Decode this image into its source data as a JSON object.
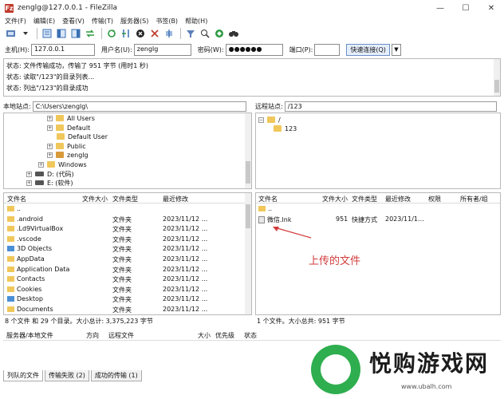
{
  "window": {
    "title": "zenglg@127.0.0.1 - FileZilla",
    "app_icon": "Fz",
    "minimize": "—",
    "maximize": "☐",
    "close": "✕"
  },
  "menu": [
    "文件(F)",
    "编辑(E)",
    "查看(V)",
    "传输(T)",
    "服务器(S)",
    "书签(B)",
    "帮助(H)"
  ],
  "quickconnect": {
    "host_label": "主机(H):",
    "host_value": "127.0.0.1",
    "user_label": "用户名(U):",
    "user_value": "zenglg",
    "pass_label": "密码(W):",
    "pass_value": "●●●●●●",
    "port_label": "端口(P):",
    "port_value": "",
    "connect_label": "快速连接(Q)",
    "dropdown_icon": "▼"
  },
  "log": [
    "状态: 文件传输成功，传输了 951 字节 (用时1 秒)",
    "状态: 读取\"/123\"的目录列表...",
    "状态: 列出\"/123\"的目录成功"
  ],
  "local": {
    "site_label": "本地站点:",
    "site_path": "C:\\Users\\zenglg\\",
    "tree": [
      {
        "label": "All Users",
        "kind": "folder"
      },
      {
        "label": "Default",
        "kind": "folder"
      },
      {
        "label": "Default User",
        "kind": "folder"
      },
      {
        "label": "Public",
        "kind": "folder"
      },
      {
        "label": "zenglg",
        "kind": "user"
      },
      {
        "label": "Windows",
        "kind": "folder"
      },
      {
        "label": "D: (代码)",
        "kind": "drive"
      },
      {
        "label": "E: (软件)",
        "kind": "drive"
      }
    ],
    "columns": [
      "文件名",
      "文件大小",
      "文件类型",
      "最近修改"
    ],
    "rows": [
      {
        "name": "..",
        "size": "",
        "type": "",
        "modified": "",
        "icon": "folder"
      },
      {
        "name": ".android",
        "size": "",
        "type": "文件夹",
        "modified": "2023/11/12 ...",
        "icon": "folder"
      },
      {
        "name": ".Ld9VirtualBox",
        "size": "",
        "type": "文件夹",
        "modified": "2023/11/12 ...",
        "icon": "folder"
      },
      {
        "name": ".vscode",
        "size": "",
        "type": "文件夹",
        "modified": "2023/11/12 ...",
        "icon": "folder"
      },
      {
        "name": "3D Objects",
        "size": "",
        "type": "文件夹",
        "modified": "2023/11/12 ...",
        "icon": "blue"
      },
      {
        "name": "AppData",
        "size": "",
        "type": "文件夹",
        "modified": "2023/11/12 ...",
        "icon": "folder"
      },
      {
        "name": "Application Data",
        "size": "",
        "type": "文件夹",
        "modified": "2023/11/12 ...",
        "icon": "folder"
      },
      {
        "name": "Contacts",
        "size": "",
        "type": "文件夹",
        "modified": "2023/11/12 ...",
        "icon": "folder"
      },
      {
        "name": "Cookies",
        "size": "",
        "type": "文件夹",
        "modified": "2023/11/12 ...",
        "icon": "folder"
      },
      {
        "name": "Desktop",
        "size": "",
        "type": "文件夹",
        "modified": "2023/11/12 ...",
        "icon": "blue"
      },
      {
        "name": "Documents",
        "size": "",
        "type": "文件夹",
        "modified": "2023/11/12 ...",
        "icon": "folder"
      }
    ],
    "status": "8 个文件 和 29 个目录。大小总计: 3,375,223 字节"
  },
  "remote": {
    "site_label": "远程站点:",
    "site_path": "/123",
    "tree": [
      {
        "label": "/",
        "kind": "folder"
      },
      {
        "label": "123",
        "kind": "folder"
      }
    ],
    "columns": [
      "文件名",
      "文件大小",
      "文件类型",
      "最近修改",
      "权限",
      "所有者/组"
    ],
    "rows": [
      {
        "name": "..",
        "size": "",
        "type": "",
        "modified": "",
        "icon": "folder"
      },
      {
        "name": "微信.lnk",
        "size": "951",
        "type": "快捷方式",
        "modified": "2023/11/1...",
        "icon": "doc"
      }
    ],
    "status": "1 个文件。大小总共: 951 字节",
    "annotation": "上传的文件"
  },
  "queue": {
    "columns": [
      "服务器/本地文件",
      "方向",
      "远程文件",
      "大小",
      "优先级",
      "状态"
    ]
  },
  "tabs": [
    "列队的文件",
    "传输失败 (2)",
    "成功的传输 (1)"
  ],
  "watermark": {
    "text": "悦购游戏网",
    "url": "www.ubalh.com"
  },
  "colors": {
    "annotation": "#d23b3b",
    "folder": "#f0c75a",
    "watermark_green": "#2eae4f"
  }
}
